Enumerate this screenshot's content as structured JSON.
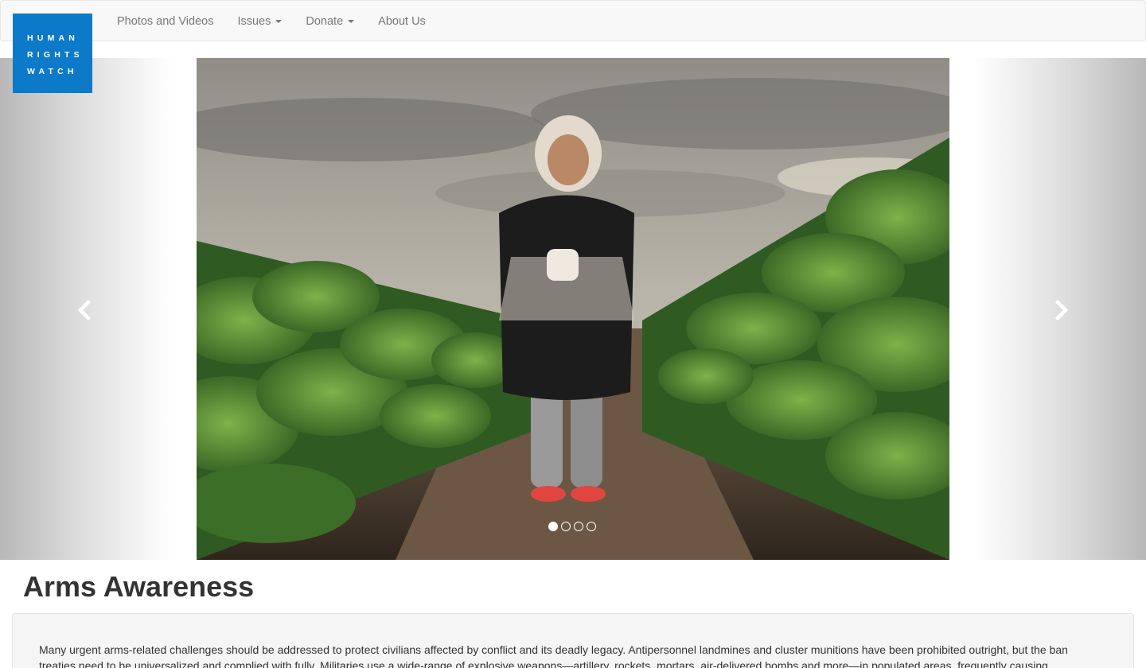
{
  "logo": {
    "lines": [
      "HUMAN",
      "RIGHTS",
      "WATCH"
    ],
    "color": "#0d79c9"
  },
  "nav": {
    "items": [
      {
        "label": "Photos and Videos",
        "dropdown": false
      },
      {
        "label": "Issues",
        "dropdown": true
      },
      {
        "label": "Donate",
        "dropdown": true
      },
      {
        "label": "About Us",
        "dropdown": false
      }
    ]
  },
  "carousel": {
    "prev_icon": "chevron-left-icon",
    "next_icon": "chevron-right-icon",
    "slide_count": 4,
    "active_index": 0
  },
  "content": {
    "title": "Arms Awareness",
    "intro": "Many urgent arms-related challenges should be addressed to protect civilians affected by conflict and its deadly legacy. Antipersonnel landmines and cluster munitions have been prohibited outright, but the ban treaties need to be universalized and complied with fully. Militaries use a wide-range of explosive weapons—artillery, rockets, mortars, air-delivered bombs and more—in populated areas, frequently causing"
  }
}
